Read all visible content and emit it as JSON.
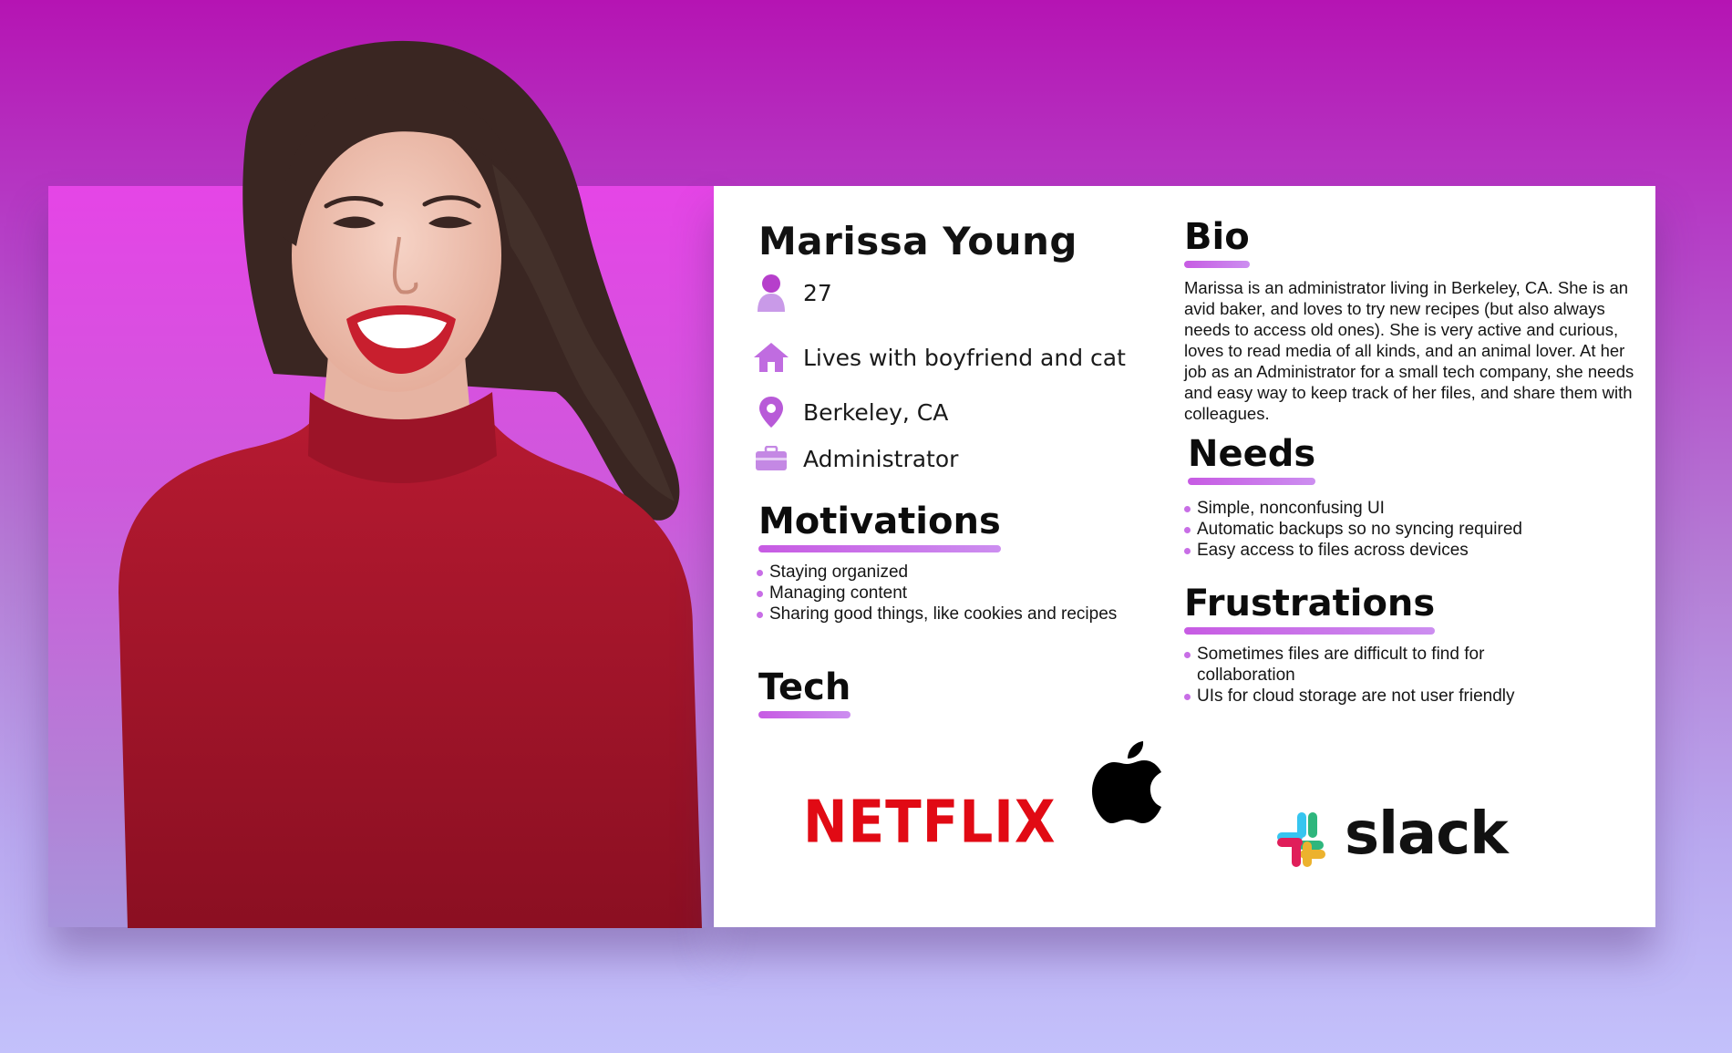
{
  "persona": {
    "name": "Marissa Young",
    "age": "27",
    "household": "Lives with boyfriend and cat",
    "location": "Berkeley, CA",
    "occupation": "Administrator"
  },
  "icons": {
    "age": "person-icon",
    "household": "home-icon",
    "location": "location-pin-icon",
    "occupation": "briefcase-icon"
  },
  "sections": {
    "motivations": {
      "title": "Motivations",
      "items": [
        "Staying organized",
        "Managing content",
        "Sharing good things, like cookies and recipes"
      ]
    },
    "tech": {
      "title": "Tech",
      "logos": {
        "netflix": "NETFLIX",
        "apple": "apple-logo-icon",
        "slack": "slack"
      }
    },
    "bio": {
      "title": "Bio",
      "text": "Marissa is an administrator living in Berkeley, CA. She is an avid baker, and loves to try new recipes (but also always needs to access old ones). She is very active and curious, loves to read media of all kinds, and an animal lover. At her job as an Administrator for a small tech company, she needs and easy way to keep track of her files, and share them with colleagues."
    },
    "needs": {
      "title": "Needs",
      "items": [
        "Simple, nonconfusing UI",
        "Automatic backups so no syncing required",
        "Easy access to files across devices"
      ]
    },
    "frustrations": {
      "title": "Frustrations",
      "items": [
        "Sometimes files are difficult to find for collaboration",
        "UIs for cloud storage are not user friendly"
      ]
    }
  },
  "colors": {
    "accent": "#c75be3",
    "netflix_red": "#e10a14",
    "shirt_red": "#a0152a"
  }
}
